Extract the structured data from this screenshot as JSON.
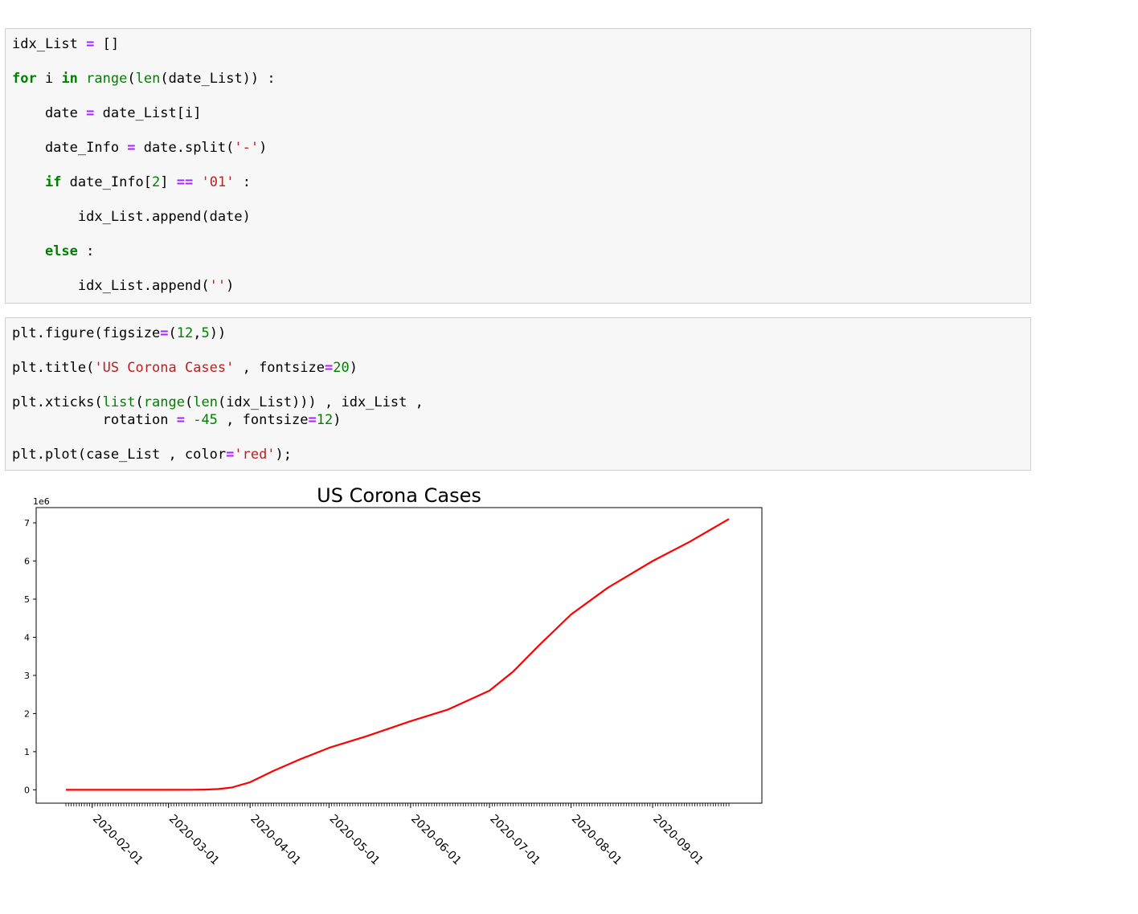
{
  "code_cells": [
    {
      "lines": [
        [
          {
            "t": "idx_List ",
            "c": "tx"
          },
          {
            "t": "=",
            "c": "op"
          },
          {
            "t": " []",
            "c": "tx"
          }
        ],
        [
          {
            "t": "for",
            "c": "kw"
          },
          {
            "t": " i ",
            "c": "tx"
          },
          {
            "t": "in",
            "c": "kw"
          },
          {
            "t": " ",
            "c": "tx"
          },
          {
            "t": "range",
            "c": "bi"
          },
          {
            "t": "(",
            "c": "tx"
          },
          {
            "t": "len",
            "c": "bi"
          },
          {
            "t": "(date_List)) :",
            "c": "tx"
          }
        ],
        [
          {
            "t": "    date ",
            "c": "tx"
          },
          {
            "t": "=",
            "c": "op"
          },
          {
            "t": " date_List[i]",
            "c": "tx"
          }
        ],
        [
          {
            "t": "    date_Info ",
            "c": "tx"
          },
          {
            "t": "=",
            "c": "op"
          },
          {
            "t": " date.split(",
            "c": "tx"
          },
          {
            "t": "'-'",
            "c": "st"
          },
          {
            "t": ")",
            "c": "tx"
          }
        ],
        [
          {
            "t": "    ",
            "c": "tx"
          },
          {
            "t": "if",
            "c": "kw"
          },
          {
            "t": " date_Info[",
            "c": "tx"
          },
          {
            "t": "2",
            "c": "nm"
          },
          {
            "t": "] ",
            "c": "tx"
          },
          {
            "t": "==",
            "c": "op"
          },
          {
            "t": " ",
            "c": "tx"
          },
          {
            "t": "'01'",
            "c": "st"
          },
          {
            "t": " :",
            "c": "tx"
          }
        ],
        [
          {
            "t": "        idx_List.append(date)",
            "c": "tx"
          }
        ],
        [
          {
            "t": "    ",
            "c": "tx"
          },
          {
            "t": "else",
            "c": "kw"
          },
          {
            "t": " :",
            "c": "tx"
          }
        ],
        [
          {
            "t": "        idx_List.append(",
            "c": "tx"
          },
          {
            "t": "''",
            "c": "st"
          },
          {
            "t": ")",
            "c": "tx"
          }
        ]
      ]
    },
    {
      "lines": [
        [
          {
            "t": "plt.figure(figsize",
            "c": "tx"
          },
          {
            "t": "=",
            "c": "op"
          },
          {
            "t": "(",
            "c": "tx"
          },
          {
            "t": "12",
            "c": "nm"
          },
          {
            "t": ",",
            "c": "tx"
          },
          {
            "t": "5",
            "c": "nm"
          },
          {
            "t": "))",
            "c": "tx"
          }
        ],
        [
          {
            "t": "plt.title(",
            "c": "tx"
          },
          {
            "t": "'US Corona Cases'",
            "c": "st"
          },
          {
            "t": " , fontsize",
            "c": "tx"
          },
          {
            "t": "=",
            "c": "op"
          },
          {
            "t": "20",
            "c": "nm"
          },
          {
            "t": ")",
            "c": "tx"
          }
        ],
        [
          {
            "t": "plt.xticks(",
            "c": "tx"
          },
          {
            "t": "list",
            "c": "bi"
          },
          {
            "t": "(",
            "c": "tx"
          },
          {
            "t": "range",
            "c": "bi"
          },
          {
            "t": "(",
            "c": "tx"
          },
          {
            "t": "len",
            "c": "bi"
          },
          {
            "t": "(idx_List))) , idx_List ,",
            "c": "tx"
          }
        ],
        [
          {
            "t": "           rotation ",
            "c": "tx"
          },
          {
            "t": "=",
            "c": "op"
          },
          {
            "t": " ",
            "c": "tx"
          },
          {
            "t": "-45",
            "c": "nm"
          },
          {
            "t": " , fontsize",
            "c": "tx"
          },
          {
            "t": "=",
            "c": "op"
          },
          {
            "t": "12",
            "c": "nm"
          },
          {
            "t": ")",
            "c": "tx"
          }
        ],
        [
          {
            "t": "plt.plot(case_List , color",
            "c": "tx"
          },
          {
            "t": "=",
            "c": "op"
          },
          {
            "t": "'red'",
            "c": "st"
          },
          {
            "t": ");",
            "c": "tx"
          }
        ]
      ]
    }
  ],
  "chart_data": {
    "type": "line",
    "title": "US Corona Cases",
    "xlabel": "",
    "ylabel": "",
    "y_offset_label": "1e6",
    "categories": [
      "2020-02-01",
      "2020-03-01",
      "2020-04-01",
      "2020-05-01",
      "2020-06-01",
      "2020-07-01",
      "2020-08-01",
      "2020-09-01"
    ],
    "yticks": [
      "0",
      "1",
      "2",
      "3",
      "4",
      "5",
      "6",
      "7"
    ],
    "ylim": [
      -0.35,
      7.4
    ],
    "grid": false,
    "series_color": "#ff0000",
    "series": [
      {
        "x": [
          "2020-01-22",
          "2020-02-01",
          "2020-03-01",
          "2020-03-10",
          "2020-03-15",
          "2020-03-20",
          "2020-03-25",
          "2020-04-01",
          "2020-04-10",
          "2020-04-20",
          "2020-05-01",
          "2020-05-15",
          "2020-06-01",
          "2020-06-15",
          "2020-07-01",
          "2020-07-10",
          "2020-07-20",
          "2020-08-01",
          "2020-08-15",
          "2020-09-01",
          "2020-09-15",
          "2020-09-30"
        ],
        "values": [
          0,
          0,
          0,
          0.001,
          0.005,
          0.02,
          0.06,
          0.2,
          0.5,
          0.8,
          1.1,
          1.4,
          1.8,
          2.1,
          2.6,
          3.1,
          3.8,
          4.6,
          5.3,
          6.0,
          6.5,
          7.1
        ]
      }
    ]
  }
}
